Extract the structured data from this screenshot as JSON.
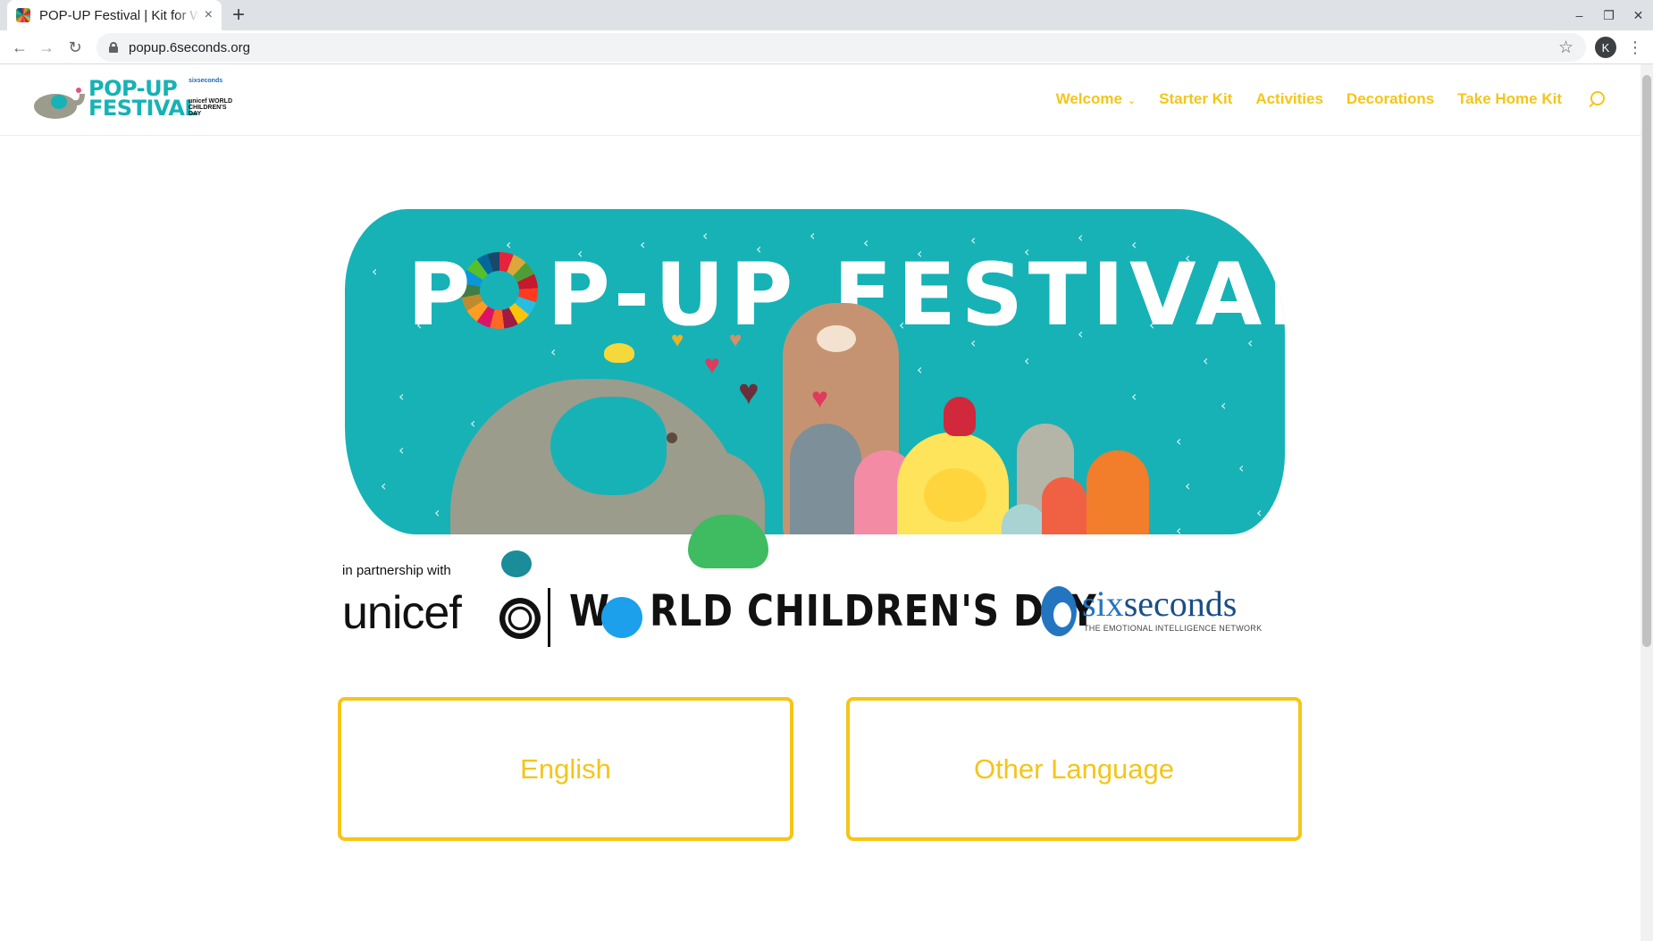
{
  "browser": {
    "tab_title": "POP-UP Festival | Kit for World Children's Day",
    "url": "popup.6seconds.org",
    "profile_initial": "K",
    "new_tab_label": "+",
    "close_tab_label": "×",
    "minimize_label": "–",
    "restore_label": "❐",
    "close_label": "✕",
    "back_label": "←",
    "forward_label": "→",
    "reload_label": "↻",
    "star_label": "☆",
    "menu_label": "⋮"
  },
  "site": {
    "logo_line1": "POP-UP",
    "logo_line2": "FESTIVAL",
    "logo_small": "sixseconds",
    "logo_small2": "unicef WORLD CHILDREN'S DAY",
    "nav": [
      {
        "label": "Welcome",
        "has_dropdown": true
      },
      {
        "label": "Starter Kit"
      },
      {
        "label": "Activities"
      },
      {
        "label": "Decorations"
      },
      {
        "label": "Take Home Kit"
      }
    ],
    "nav_caret": "⌄"
  },
  "hero": {
    "title_part1": "P",
    "title_part2": "P-UP FESTIVAL",
    "partner_text": "in partnership with",
    "unicef": "unicef",
    "wcd_w": "W",
    "wcd_rest": "RLD CHILDREN'S DAY",
    "six_part1": "six",
    "six_part2": "seconds",
    "six_sub": "THE EMOTIONAL INTELLIGENCE NETWORK"
  },
  "languages": {
    "english": "English",
    "other": "Other Language"
  },
  "colors": {
    "accent": "#f5c518",
    "teal": "#16b2b6",
    "sixseconds_blue": "#2375c0"
  }
}
